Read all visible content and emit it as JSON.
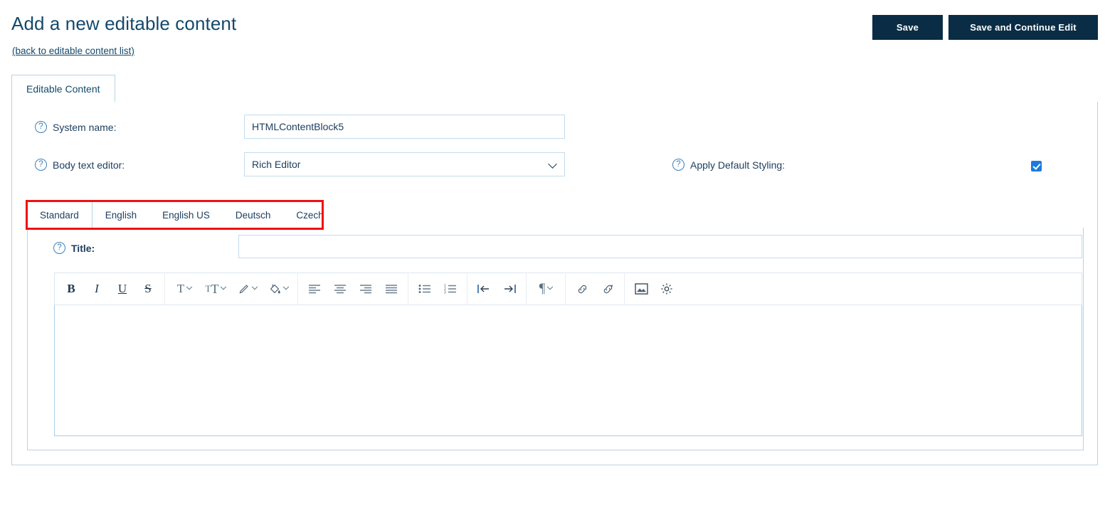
{
  "header": {
    "title": "Add a new editable content",
    "back_link": "(back to editable content list)",
    "save_label": "Save",
    "save_continue_label": "Save and Continue Edit"
  },
  "tabs": {
    "main_tab": "Editable Content"
  },
  "form": {
    "system_name": {
      "label": "System name:",
      "value": "HTMLContentBlock5",
      "help_icon": "question-mark-icon"
    },
    "body_text_editor": {
      "label": "Body text editor:",
      "value": "Rich Editor",
      "options": [
        "Rich Editor"
      ],
      "help_icon": "question-mark-icon"
    },
    "apply_default_styling": {
      "label": "Apply Default Styling:",
      "checked": true,
      "help_icon": "question-mark-icon"
    },
    "title_field": {
      "label": "Title:",
      "value": "",
      "placeholder": "",
      "help_icon": "question-mark-icon"
    }
  },
  "language_tabs": [
    {
      "label": "Standard",
      "active": true
    },
    {
      "label": "English",
      "active": false
    },
    {
      "label": "English US",
      "active": false
    },
    {
      "label": "Deutsch",
      "active": false
    },
    {
      "label": "Czech",
      "active": false
    }
  ],
  "editor": {
    "content": "",
    "toolbar_groups": [
      {
        "buttons": [
          {
            "name": "bold",
            "glyph": "B",
            "style": "b"
          },
          {
            "name": "italic",
            "glyph": "I",
            "style": "i"
          },
          {
            "name": "underline",
            "glyph": "U",
            "style": "u"
          },
          {
            "name": "strikethrough",
            "glyph": "S",
            "style": "s"
          }
        ]
      },
      {
        "buttons": [
          {
            "name": "font-family",
            "glyph": "T",
            "caret": true
          },
          {
            "name": "font-size",
            "glyph": "тT",
            "caret": true
          },
          {
            "name": "text-color",
            "glyph": "pen-icon",
            "caret": true
          },
          {
            "name": "highlight-color",
            "glyph": "bucket-icon",
            "caret": true
          }
        ]
      },
      {
        "buttons": [
          {
            "name": "align-left",
            "glyph": "align-left-icon"
          },
          {
            "name": "align-center",
            "glyph": "align-center-icon"
          },
          {
            "name": "align-right",
            "glyph": "align-right-icon"
          },
          {
            "name": "align-justify",
            "glyph": "align-justify-icon"
          }
        ]
      },
      {
        "buttons": [
          {
            "name": "bullet-list",
            "glyph": "bullet-list-icon"
          },
          {
            "name": "numbered-list",
            "glyph": "numbered-list-icon"
          }
        ]
      },
      {
        "buttons": [
          {
            "name": "outdent",
            "glyph": "outdent-icon"
          },
          {
            "name": "indent",
            "glyph": "indent-icon"
          }
        ]
      },
      {
        "buttons": [
          {
            "name": "paragraph-format",
            "glyph": "¶",
            "caret": true
          }
        ]
      },
      {
        "buttons": [
          {
            "name": "insert-link",
            "glyph": "link-icon"
          },
          {
            "name": "unlink",
            "glyph": "unlink-icon"
          }
        ]
      },
      {
        "buttons": [
          {
            "name": "insert-image",
            "glyph": "image-icon"
          },
          {
            "name": "editor-settings",
            "glyph": "gear-icon"
          }
        ]
      }
    ]
  },
  "annotation": {
    "highlight_color": "#ee1111",
    "target": "language-tabs"
  },
  "colors": {
    "button_bg": "#0a2d45",
    "border": "#b8d4e3",
    "text": "#1b3d5c",
    "checkbox": "#1b7ae0",
    "annotation": "#ee1111"
  }
}
